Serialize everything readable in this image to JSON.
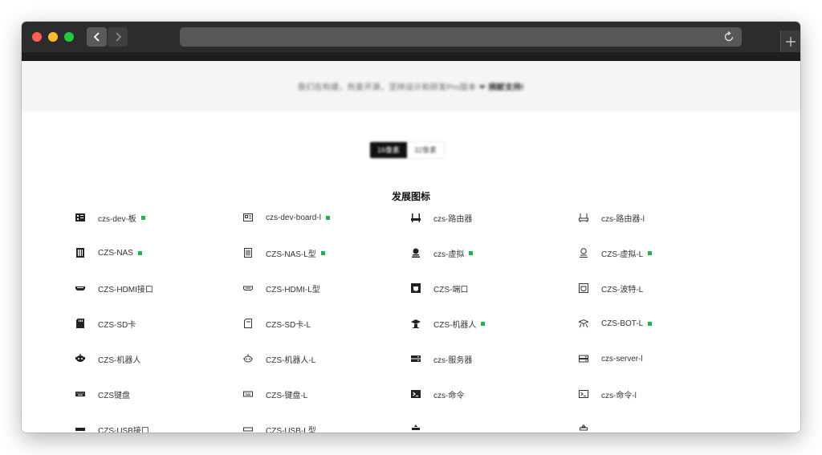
{
  "browser": {
    "url": "",
    "back_icon": "chevron-left-icon",
    "forward_icon": "chevron-right-icon",
    "reload_icon": "reload-icon",
    "new_tab_icon": "plus-icon"
  },
  "banner": {
    "text": "我们在构建，热爱开源，坚持设计和研发Pro版本 ❤",
    "link": "捐献支持!"
  },
  "toggle": {
    "options": [
      "16像素",
      "32像素"
    ],
    "active_index": 0
  },
  "section_title": "发展图标",
  "accent_color": "#22b24c",
  "rows": [
    [
      {
        "icon": "dev-board-solid-icon",
        "label": "czs-dev-板",
        "new": true
      },
      {
        "icon": "dev-board-line-icon",
        "label": "czs-dev-board-l",
        "new": true
      },
      {
        "icon": "router-solid-icon",
        "label": "czs-路由器",
        "new": false
      },
      {
        "icon": "router-line-icon",
        "label": "czs-路由器-l",
        "new": false
      }
    ],
    [
      {
        "icon": "nas-solid-icon",
        "label": "CZS-NAS",
        "new": true
      },
      {
        "icon": "nas-line-icon",
        "label": "CZS-NAS-L型",
        "new": true
      },
      {
        "icon": "virtual-solid-icon",
        "label": "czs-虚拟",
        "new": true
      },
      {
        "icon": "virtual-line-icon",
        "label": "CZS-虚拟-L",
        "new": true
      }
    ],
    [
      {
        "icon": "hdmi-solid-icon",
        "label": "CZS-HDMI接口",
        "new": false
      },
      {
        "icon": "hdmi-line-icon",
        "label": "CZS-HDMI-L型",
        "new": false
      },
      {
        "icon": "port-solid-icon",
        "label": "CZS-端口",
        "new": false
      },
      {
        "icon": "port-line-icon",
        "label": "CZS-波特-L",
        "new": false
      }
    ],
    [
      {
        "icon": "sd-card-solid-icon",
        "label": "CZS-SD卡",
        "new": false
      },
      {
        "icon": "sd-card-line-icon",
        "label": "CZS-SD卡-L",
        "new": false
      },
      {
        "icon": "robot-solid-icon",
        "label": "CZS-机器人",
        "new": true
      },
      {
        "icon": "robot-line-icon",
        "label": "CZS-BOT-L",
        "new": true
      }
    ],
    [
      {
        "icon": "robot-head-solid-icon",
        "label": "CZS-机器人",
        "new": false
      },
      {
        "icon": "robot-head-line-icon",
        "label": "CZS-机器人-L",
        "new": false
      },
      {
        "icon": "server-solid-icon",
        "label": "czs-服务器",
        "new": false
      },
      {
        "icon": "server-line-icon",
        "label": "czs-server-l",
        "new": false
      }
    ],
    [
      {
        "icon": "keyboard-solid-icon",
        "label": "CZS键盘",
        "new": false
      },
      {
        "icon": "keyboard-line-icon",
        "label": "CZS-键盘-L",
        "new": false
      },
      {
        "icon": "terminal-solid-icon",
        "label": "czs-命令",
        "new": false
      },
      {
        "icon": "terminal-line-icon",
        "label": "czs-命令-l",
        "new": false
      }
    ],
    [
      {
        "icon": "usb-solid-icon",
        "label": "CZS-USB接口",
        "new": false
      },
      {
        "icon": "usb-line-icon",
        "label": "CZS-USB-L型",
        "new": false
      },
      {
        "icon": "modem-solid-icon",
        "label": "",
        "new": false
      },
      {
        "icon": "modem-line-icon",
        "label": "",
        "new": false
      }
    ]
  ]
}
